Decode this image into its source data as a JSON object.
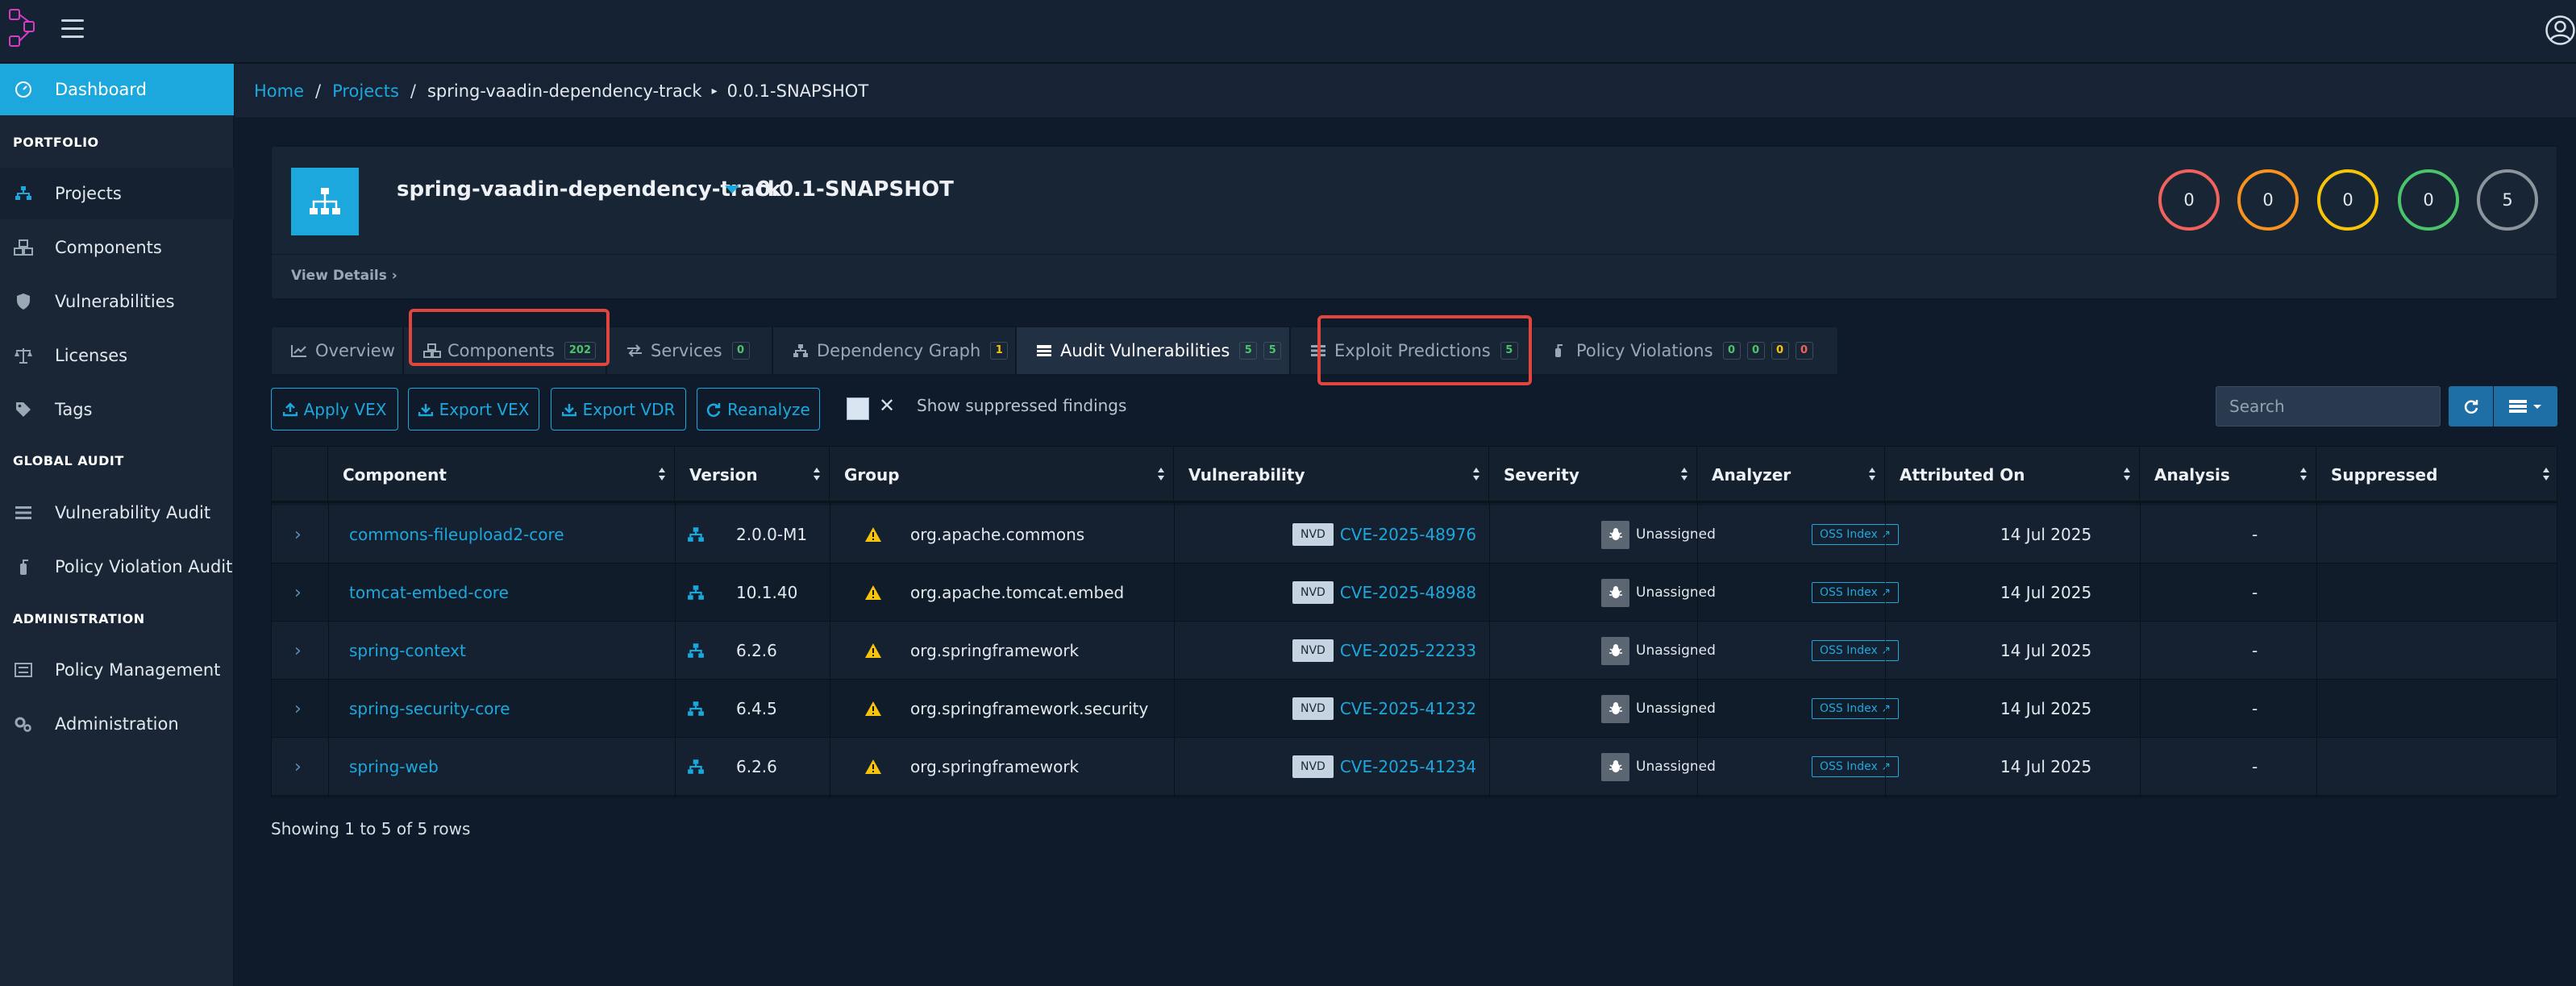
{
  "topbar": {
    "menu_icon": "hamburger-icon",
    "user_icon": "user-icon",
    "logo_icon": "app-logo"
  },
  "sidebar": {
    "dashboard": "Dashboard",
    "sections": {
      "portfolio": "PORTFOLIO",
      "global_audit": "GLOBAL AUDIT",
      "administration": "ADMINISTRATION"
    },
    "items": {
      "projects": "Projects",
      "components": "Components",
      "vulnerabilities": "Vulnerabilities",
      "licenses": "Licenses",
      "tags": "Tags",
      "vulnerability_audit": "Vulnerability Audit",
      "policy_violation_audit": "Policy Violation Audit",
      "policy_management": "Policy Management",
      "administration": "Administration"
    }
  },
  "breadcrumb": {
    "home": "Home",
    "projects": "Projects",
    "project": "spring-vaadin-dependency-track",
    "version": "0.0.1-SNAPSHOT"
  },
  "project": {
    "name": "spring-vaadin-dependency-track",
    "version": "0.0.1-SNAPSHOT",
    "view_details": "View Details",
    "severity_counts": [
      {
        "value": "0",
        "color": "#f0625d"
      },
      {
        "value": "0",
        "color": "#f7931e"
      },
      {
        "value": "0",
        "color": "#f7c40b"
      },
      {
        "value": "0",
        "color": "#4cc36a"
      },
      {
        "value": "5",
        "color": "#8c949c"
      }
    ]
  },
  "tabs": {
    "overview": "Overview",
    "components": "Components",
    "components_badge": "202",
    "services": "Services",
    "services_badge": "0",
    "dependency_graph": "Dependency Graph",
    "dependency_graph_badge": "1",
    "audit_vulnerabilities": "Audit Vulnerabilities",
    "audit_badge_1": "5",
    "audit_badge_2": "5",
    "exploit_predictions": "Exploit Predictions",
    "exploit_badge": "5",
    "policy_violations": "Policy Violations",
    "policy_badges": [
      "0",
      "0",
      "0",
      "0"
    ]
  },
  "toolbar": {
    "apply_vex": "Apply VEX",
    "export_vex": "Export VEX",
    "export_vdr": "Export VDR",
    "reanalyze": "Reanalyze",
    "show_suppressed": "Show suppressed findings",
    "suppress_clear": "✕",
    "search_placeholder": "Search"
  },
  "table": {
    "columns": {
      "component": "Component",
      "version": "Version",
      "group": "Group",
      "vulnerability": "Vulnerability",
      "severity": "Severity",
      "analyzer": "Analyzer",
      "attributed_on": "Attributed On",
      "analysis": "Analysis",
      "suppressed": "Suppressed"
    },
    "rows": [
      {
        "component": "commons-fileupload2-core",
        "version": "2.0.0-M1",
        "group": "org.apache.commons",
        "source": "NVD",
        "vulnerability": "CVE-2025-48976",
        "severity": "Unassigned",
        "analyzer": "OSS Index",
        "attributed_on": "14 Jul 2025",
        "analysis": "-"
      },
      {
        "component": "tomcat-embed-core",
        "version": "10.1.40",
        "group": "org.apache.tomcat.embed",
        "source": "NVD",
        "vulnerability": "CVE-2025-48988",
        "severity": "Unassigned",
        "analyzer": "OSS Index",
        "attributed_on": "14 Jul 2025",
        "analysis": "-"
      },
      {
        "component": "spring-context",
        "version": "6.2.6",
        "group": "org.springframework",
        "source": "NVD",
        "vulnerability": "CVE-2025-22233",
        "severity": "Unassigned",
        "analyzer": "OSS Index",
        "attributed_on": "14 Jul 2025",
        "analysis": "-"
      },
      {
        "component": "spring-security-core",
        "version": "6.4.5",
        "group": "org.springframework.security",
        "source": "NVD",
        "vulnerability": "CVE-2025-41232",
        "severity": "Unassigned",
        "analyzer": "OSS Index",
        "attributed_on": "14 Jul 2025",
        "analysis": "-"
      },
      {
        "component": "spring-web",
        "version": "6.2.6",
        "group": "org.springframework",
        "source": "NVD",
        "vulnerability": "CVE-2025-41234",
        "severity": "Unassigned",
        "analyzer": "OSS Index",
        "attributed_on": "14 Jul 2025",
        "analysis": "-"
      }
    ]
  },
  "footer": {
    "showing": "Showing 1 to 5 of 5 rows"
  },
  "colors": {
    "accent": "#1ca8dd",
    "highlight": "#e0463e",
    "warning": "#f7c40b"
  }
}
